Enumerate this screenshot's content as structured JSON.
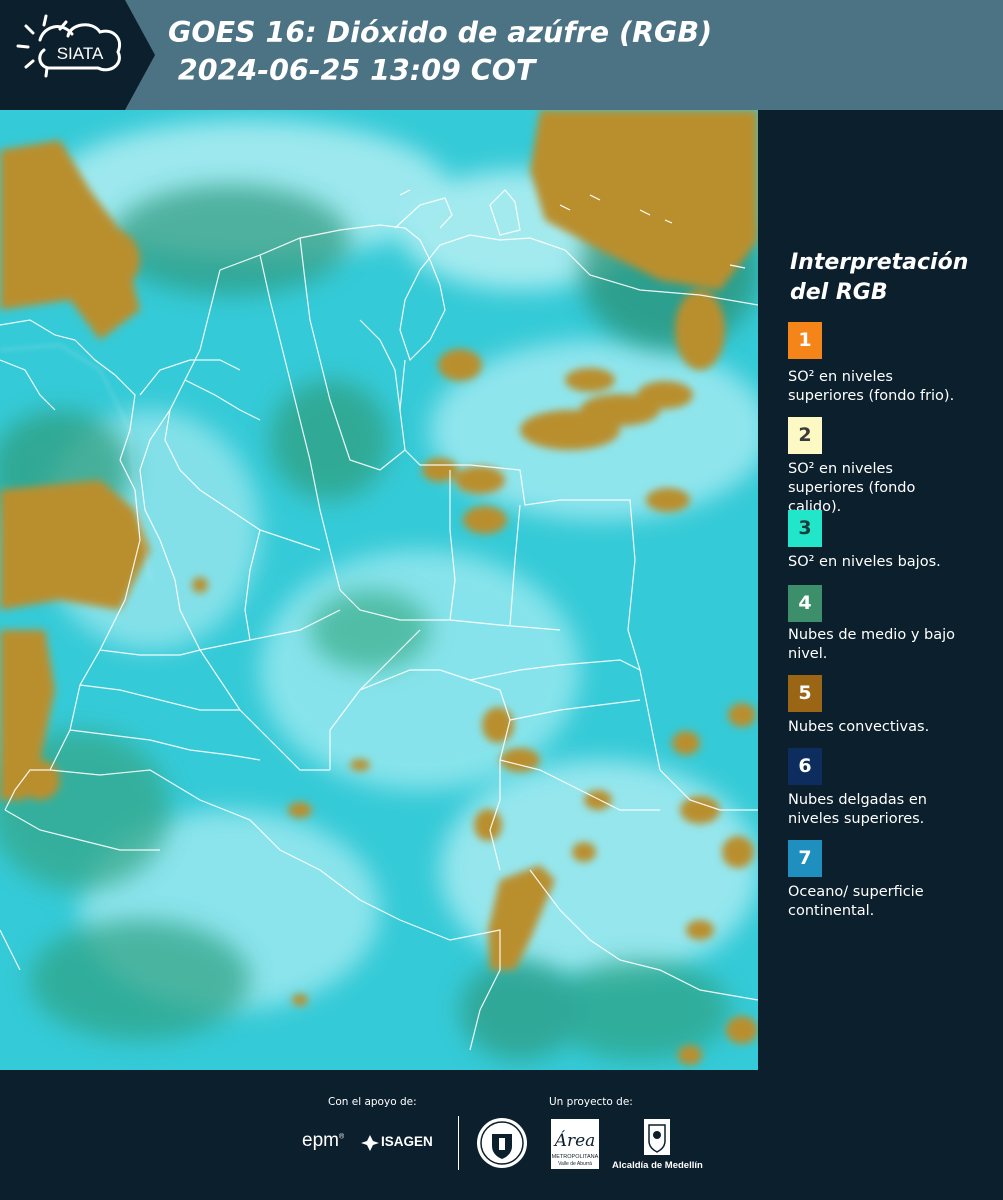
{
  "header": {
    "logo_text": "SIATA",
    "title_line1": "GOES 16: Dióxido de azúfre (RGB)",
    "title_line2": " 2024-06-25 13:09 COT"
  },
  "legend": {
    "title": "Interpretación\ndel RGB",
    "items": [
      {
        "number": "1",
        "color": "#f68519",
        "text_color": "#ffffff",
        "label": "SO² en niveles superiores (fondo frio)."
      },
      {
        "number": "2",
        "color": "#fdf9c4",
        "text_color": "#3a3a3a",
        "label": "SO² en niveles superiores (fondo calido)."
      },
      {
        "number": "3",
        "color": "#22e6c9",
        "text_color": "#1b3b3b",
        "label": "SO² en niveles bajos."
      },
      {
        "number": "4",
        "color": "#3c8f6a",
        "text_color": "#ffffff",
        "label": "Nubes de medio y bajo nivel."
      },
      {
        "number": "5",
        "color": "#9a6514",
        "text_color": "#ffffff",
        "label": "Nubes convectivas."
      },
      {
        "number": "6",
        "color": "#0d2d5e",
        "text_color": "#ffffff",
        "label": "Nubes delgadas en niveles superiores."
      },
      {
        "number": "7",
        "color": "#1f8fbf",
        "text_color": "#ffffff",
        "label": "Oceano/ superficie continental."
      }
    ]
  },
  "footer": {
    "support_label": "Con el apoyo de:",
    "project_label": "Un proyecto de:",
    "logos": {
      "epm": "epm",
      "isagen": "ISAGEN",
      "metropolitana": "Área",
      "metropolitana_sub": "METROPOLITANA",
      "metropolitana_sub2": "Valle de Aburrá",
      "alcaldia": "Alcaldía de Medellín"
    }
  }
}
